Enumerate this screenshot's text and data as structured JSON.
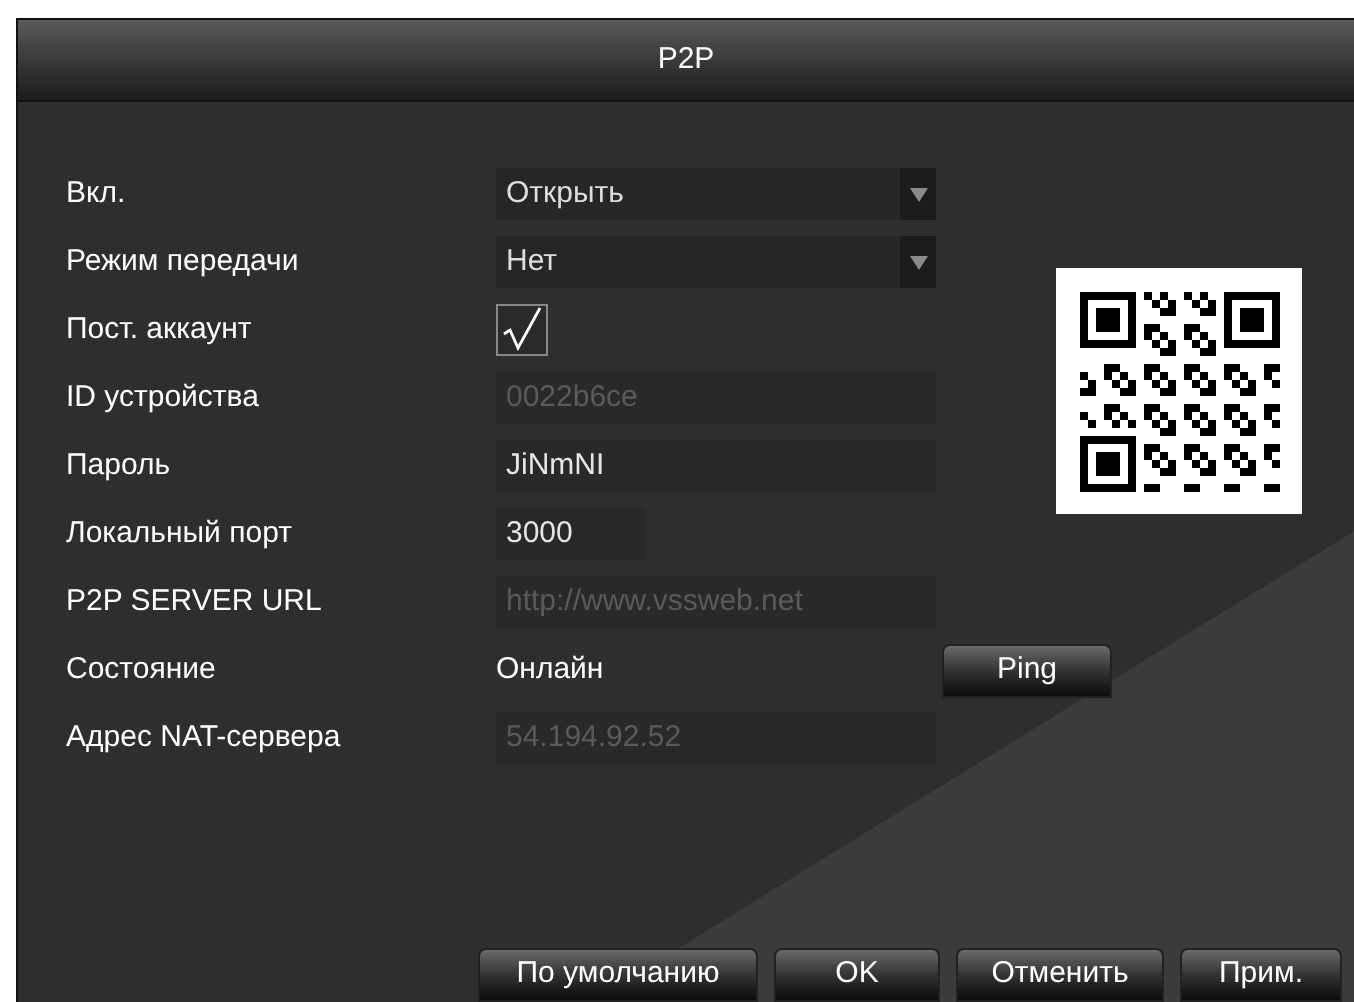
{
  "window": {
    "title": "P2P"
  },
  "fields": [
    {
      "label": "Вкл.",
      "kind": "select",
      "value": "Открыть"
    },
    {
      "label": "Режим передачи",
      "kind": "select",
      "value": "Нет"
    },
    {
      "label": "Пост. аккаунт",
      "kind": "checkbox",
      "checked": true
    },
    {
      "label": "ID устройства",
      "kind": "text",
      "value": "0022b6ce",
      "disabled": true
    },
    {
      "label": "Пароль",
      "kind": "text",
      "value": "JiNmNI",
      "disabled": false
    },
    {
      "label": "Локальный порт",
      "kind": "short",
      "value": "3000",
      "disabled": false
    },
    {
      "label": "P2P SERVER URL",
      "kind": "text",
      "value": "http://www.vssweb.net",
      "disabled": true
    },
    {
      "label": "Состояние",
      "kind": "status",
      "value": "Онлайн",
      "button": "Ping"
    },
    {
      "label": "Адрес NAT-сервера",
      "kind": "text",
      "value": "54.194.92.52",
      "disabled": true
    }
  ],
  "buttons": [
    "По умолчанию",
    "OK",
    "Отменить",
    "Прим."
  ]
}
